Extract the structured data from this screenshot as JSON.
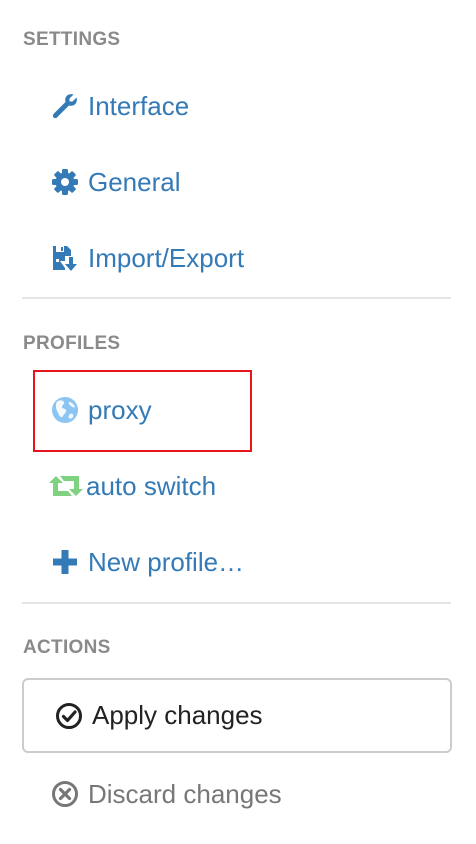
{
  "settings": {
    "header": "SETTINGS",
    "items": [
      {
        "label": "Interface",
        "icon": "wrench-icon"
      },
      {
        "label": "General",
        "icon": "gear-icon"
      },
      {
        "label": "Import/Export",
        "icon": "save-import-icon"
      }
    ]
  },
  "profiles": {
    "header": "PROFILES",
    "items": [
      {
        "label": "proxy",
        "icon": "globe-icon",
        "highlighted": true
      },
      {
        "label": "auto switch",
        "icon": "retweet-icon"
      },
      {
        "label": "New profile…",
        "icon": "plus-icon"
      }
    ]
  },
  "actions": {
    "header": "ACTIONS",
    "apply_label": "Apply changes",
    "discard_label": "Discard changes"
  },
  "colors": {
    "link": "#337ab7",
    "header": "#8a8a8a",
    "highlight": "#e8141b",
    "autoswitch_icon": "#7fd27f",
    "globe_icon": "#5aa5e8"
  }
}
